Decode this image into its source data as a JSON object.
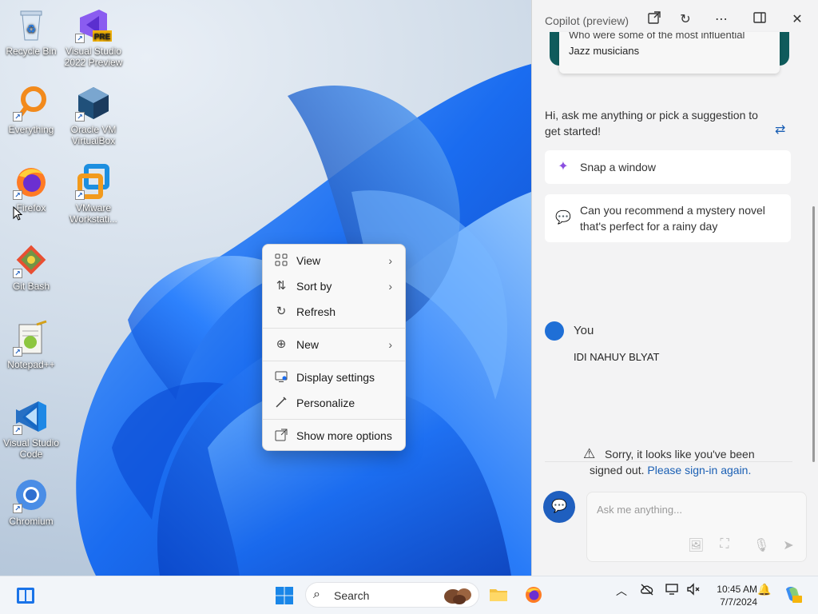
{
  "desktop": {
    "icons": [
      {
        "label": "Recycle Bin",
        "icon": "recycle-bin-icon"
      },
      {
        "label": "Visual Studio 2022 Preview",
        "icon": "visual-studio-icon",
        "badge": "PRE"
      },
      {
        "label": "Everything",
        "icon": "everything-search-icon"
      },
      {
        "label": "Oracle VM VirtualBox",
        "icon": "virtualbox-icon"
      },
      {
        "label": "Firefox",
        "icon": "firefox-icon"
      },
      {
        "label": "VMware Workstati...",
        "icon": "vmware-icon"
      },
      {
        "label": "Git Bash",
        "icon": "git-bash-icon"
      },
      {
        "label": "Notepad++",
        "icon": "notepad-plus-plus-icon"
      },
      {
        "label": "Visual Studio Code",
        "icon": "vscode-icon"
      },
      {
        "label": "Chromium",
        "icon": "chromium-icon"
      }
    ]
  },
  "context_menu": {
    "items": [
      {
        "label": "View",
        "icon": "grid-view-icon",
        "submenu": true
      },
      {
        "label": "Sort by",
        "icon": "sort-icon",
        "submenu": true
      },
      {
        "label": "Refresh",
        "icon": "refresh-icon",
        "submenu": false
      },
      {
        "label": "New",
        "icon": "plus-circle-icon",
        "submenu": true
      },
      {
        "label": "Display settings",
        "icon": "display-icon",
        "submenu": false
      },
      {
        "label": "Personalize",
        "icon": "pen-icon",
        "submenu": false
      },
      {
        "label": "Show more options",
        "icon": "external-icon",
        "submenu": false
      }
    ]
  },
  "copilot": {
    "title": "Copilot (preview)",
    "top_card_lines": [
      "Who were some of the most influential",
      "Jazz musicians"
    ],
    "greeting": "Hi, ask me anything or pick a suggestion to get started!",
    "suggestions": [
      {
        "text": "Snap a window",
        "icon": "sparkle-icon"
      },
      {
        "text": "Can you recommend a mystery novel that's perfect for a rainy day",
        "icon": "chat-bubbles-icon"
      }
    ],
    "user_label": "You",
    "user_message": "IDI NAHUY BLYAT",
    "warning_text": "Sorry, it looks like you've been signed out.",
    "warning_link": "Please sign-in again.",
    "input_placeholder": "Ask me anything..."
  },
  "taskbar": {
    "search_label": "Search",
    "time": "10:45 AM",
    "date": "7/7/2024"
  },
  "colors": {
    "accent": "#1f5fbf",
    "wallpaper_blue": "#1a6cf0",
    "copilot_bg": "#f3f3f4",
    "link": "#1a5fb4"
  }
}
